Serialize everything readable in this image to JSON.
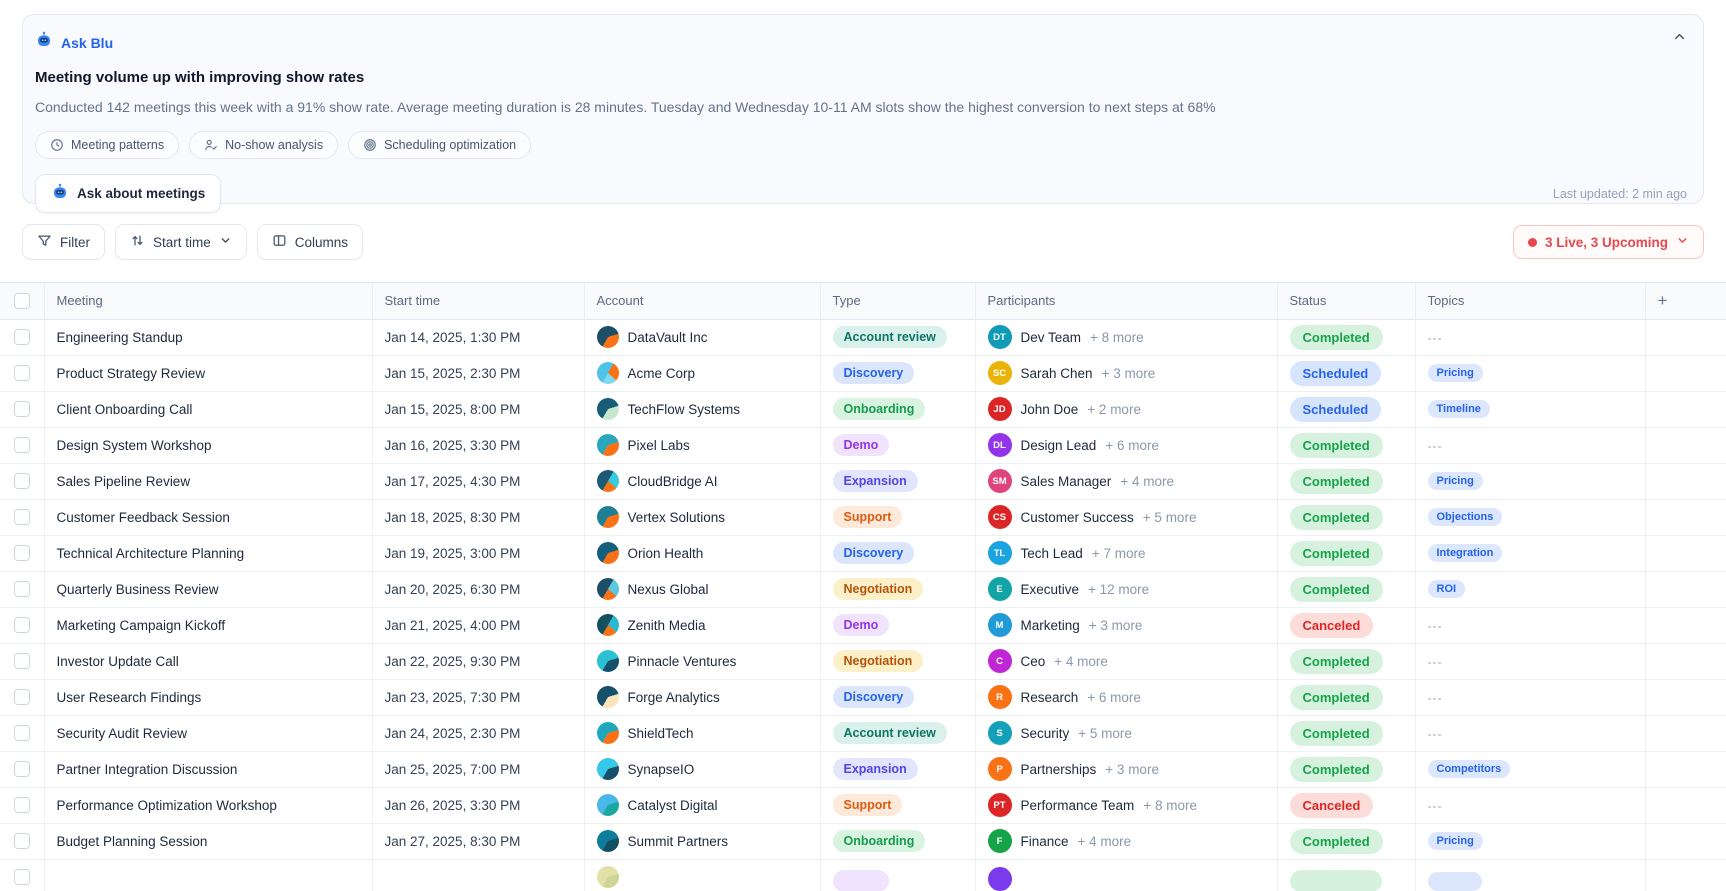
{
  "panel": {
    "brand": "Ask Blu",
    "title": "Meeting volume up with improving show rates",
    "description": "Conducted 142 meetings this week with a 91% show rate. Average meeting duration is 28 minutes. Tuesday and Wednesday 10-11 AM slots show the highest conversion to next steps at 68%",
    "chips": [
      {
        "icon": "clock-icon",
        "label": "Meeting patterns"
      },
      {
        "icon": "user-check-icon",
        "label": "No-show analysis"
      },
      {
        "icon": "target-icon",
        "label": "Scheduling optimization"
      }
    ],
    "cta": "Ask about meetings",
    "last_updated": "Last updated: 2 min ago"
  },
  "toolbar": {
    "filter_label": "Filter",
    "sort_label": "Start time",
    "columns_label": "Columns",
    "live_badge": "3 Live, 3 Upcoming"
  },
  "colors": {
    "brand_blue": "#2563eb",
    "live_red": "#e5484d"
  },
  "table": {
    "headers": [
      "Meeting",
      "Start time",
      "Account",
      "Type",
      "Participants",
      "Status",
      "Topics"
    ],
    "add_column_label": "+",
    "rows": [
      {
        "meeting": "Engineering Standup",
        "start": "Jan 14, 2025, 1:30 PM",
        "account": "DataVault Inc",
        "account_colors": [
          "#1d4e68",
          "#f97316"
        ],
        "type": "Account review",
        "type_style": "teal",
        "avatar": "DT",
        "avatar_color": "#0e9bb5",
        "participant": "Dev Team",
        "more": "+ 8 more",
        "status": "Completed",
        "status_style": "green",
        "topic": "---",
        "topic_style": null
      },
      {
        "meeting": "Product Strategy Review",
        "start": "Jan 15, 2025, 2:30 PM",
        "account": "Acme Corp",
        "account_colors": [
          "#4fc3e8",
          "#f97316",
          "#7dd8f0"
        ],
        "type": "Discovery",
        "type_style": "blue",
        "avatar": "SC",
        "avatar_color": "#eab308",
        "participant": "Sarah Chen",
        "more": "+ 3 more",
        "status": "Scheduled",
        "status_style": "blue",
        "topic": "Pricing",
        "topic_style": "blue"
      },
      {
        "meeting": "Client Onboarding Call",
        "start": "Jan 15, 2025, 8:00 PM",
        "account": "TechFlow Systems",
        "account_colors": [
          "#175d7a",
          "#c5e8cf"
        ],
        "type": "Onboarding",
        "type_style": "green",
        "avatar": "JD",
        "avatar_color": "#dc2626",
        "participant": "John Doe",
        "more": "+ 2 more",
        "status": "Scheduled",
        "status_style": "blue",
        "topic": "Timeline",
        "topic_style": "blue"
      },
      {
        "meeting": "Design System Workshop",
        "start": "Jan 16, 2025, 3:30 PM",
        "account": "Pixel Labs",
        "account_colors": [
          "#2aa7bd",
          "#f97316"
        ],
        "type": "Demo",
        "type_style": "purple",
        "avatar": "DL",
        "avatar_color": "#9333ea",
        "participant": "Design Lead",
        "more": "+ 6 more",
        "status": "Completed",
        "status_style": "green",
        "topic": "---",
        "topic_style": null
      },
      {
        "meeting": "Sales Pipeline Review",
        "start": "Jan 17, 2025, 4:30 PM",
        "account": "CloudBridge AI",
        "account_colors": [
          "#1d5b75",
          "#38cadd",
          "#f97316"
        ],
        "type": "Expansion",
        "type_style": "indigo",
        "avatar": "SM",
        "avatar_color": "#e0447c",
        "participant": "Sales Manager",
        "more": "+ 4 more",
        "status": "Completed",
        "status_style": "green",
        "topic": "Pricing",
        "topic_style": "blue"
      },
      {
        "meeting": "Customer Feedback Session",
        "start": "Jan 18, 2025, 8:30 PM",
        "account": "Vertex Solutions",
        "account_colors": [
          "#1f7f95",
          "#f97316"
        ],
        "type": "Support",
        "type_style": "orange",
        "avatar": "CS",
        "avatar_color": "#dc2626",
        "participant": "Customer Success",
        "more": "+ 5 more",
        "status": "Completed",
        "status_style": "green",
        "topic": "Objections",
        "topic_style": "blue"
      },
      {
        "meeting": "Technical Architecture Planning",
        "start": "Jan 19, 2025, 3:00 PM",
        "account": "Orion Health",
        "account_colors": [
          "#155e7d",
          "#f97316"
        ],
        "type": "Discovery",
        "type_style": "blue",
        "avatar": "TL",
        "avatar_color": "#1ba3e0",
        "participant": "Tech Lead",
        "more": "+ 7 more",
        "status": "Completed",
        "status_style": "green",
        "topic": "Integration",
        "topic_style": "blue"
      },
      {
        "meeting": "Quarterly Business Review",
        "start": "Jan 20, 2025, 6:30 PM",
        "account": "Nexus Global",
        "account_colors": [
          "#1d4e68",
          "#5bc8dd",
          "#f97316"
        ],
        "type": "Negotiation",
        "type_style": "amber",
        "avatar": "E",
        "avatar_color": "#12a5a5",
        "participant": "Executive",
        "more": "+ 12 more",
        "status": "Completed",
        "status_style": "green",
        "topic": "ROI",
        "topic_style": "blue"
      },
      {
        "meeting": "Marketing Campaign Kickoff",
        "start": "Jan 21, 2025, 4:00 PM",
        "account": "Zenith Media",
        "account_colors": [
          "#14505e",
          "#29b8cf",
          "#f97316"
        ],
        "type": "Demo",
        "type_style": "purple",
        "avatar": "M",
        "avatar_color": "#219bd8",
        "participant": "Marketing",
        "more": "+ 3 more",
        "status": "Canceled",
        "status_style": "red",
        "topic": "---",
        "topic_style": null
      },
      {
        "meeting": "Investor Update Call",
        "start": "Jan 22, 2025, 9:30 PM",
        "account": "Pinnacle Ventures",
        "account_colors": [
          "#2cc0d4",
          "#16506b"
        ],
        "type": "Negotiation",
        "type_style": "amber",
        "avatar": "C",
        "avatar_color": "#c026d3",
        "participant": "Ceo",
        "more": "+ 4 more",
        "status": "Completed",
        "status_style": "green",
        "topic": "---",
        "topic_style": null
      },
      {
        "meeting": "User Research Findings",
        "start": "Jan 23, 2025, 7:30 PM",
        "account": "Forge Analytics",
        "account_colors": [
          "#16506b",
          "#fbe3bb"
        ],
        "type": "Discovery",
        "type_style": "blue",
        "avatar": "R",
        "avatar_color": "#f97316",
        "participant": "Research",
        "more": "+ 6 more",
        "status": "Completed",
        "status_style": "green",
        "topic": "---",
        "topic_style": null
      },
      {
        "meeting": "Security Audit Review",
        "start": "Jan 24, 2025, 2:30 PM",
        "account": "ShieldTech",
        "account_colors": [
          "#20a7bd",
          "#f97316"
        ],
        "type": "Account review",
        "type_style": "teal",
        "avatar": "S",
        "avatar_color": "#14a0b8",
        "participant": "Security",
        "more": "+ 5 more",
        "status": "Completed",
        "status_style": "green",
        "topic": "---",
        "topic_style": null
      },
      {
        "meeting": "Partner Integration Discussion",
        "start": "Jan 25, 2025, 7:00 PM",
        "account": "SynapseIO",
        "account_colors": [
          "#35c8e8",
          "#16506b"
        ],
        "type": "Expansion",
        "type_style": "indigo",
        "avatar": "P",
        "avatar_color": "#f97316",
        "participant": "Partnerships",
        "more": "+ 3 more",
        "status": "Completed",
        "status_style": "green",
        "topic": "Competitors",
        "topic_style": "blue"
      },
      {
        "meeting": "Performance Optimization Workshop",
        "start": "Jan 26, 2025, 3:30 PM",
        "account": "Catalyst Digital",
        "account_colors": [
          "#49b8e8",
          "#18a8a0"
        ],
        "type": "Support",
        "type_style": "orange",
        "avatar": "PT",
        "avatar_color": "#dc2626",
        "participant": "Performance Team",
        "more": "+ 8 more",
        "status": "Canceled",
        "status_style": "red",
        "topic": "---",
        "topic_style": null
      },
      {
        "meeting": "Budget Planning Session",
        "start": "Jan 27, 2025, 8:30 PM",
        "account": "Summit Partners",
        "account_colors": [
          "#0d7d9b",
          "#134e63"
        ],
        "type": "Onboarding",
        "type_style": "green",
        "avatar": "F",
        "avatar_color": "#16a34a",
        "participant": "Finance",
        "more": "+ 4 more",
        "status": "Completed",
        "status_style": "green",
        "topic": "Pricing",
        "topic_style": "blue"
      }
    ],
    "partial_row": {
      "account_colors": [
        "#e3e0a8",
        "#cdd496"
      ],
      "type_style": "purple",
      "avatar_color": "#7c3aed",
      "status_style": "green",
      "topic_style": "blue"
    }
  }
}
